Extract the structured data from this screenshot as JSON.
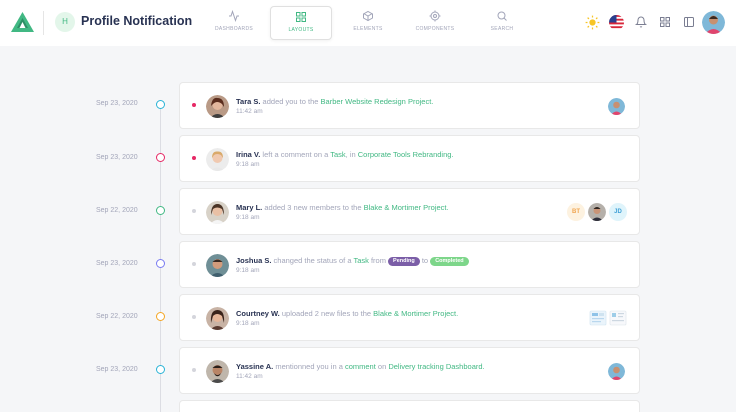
{
  "header": {
    "page_initial": "H",
    "page_title": "Profile Notification"
  },
  "nav": {
    "tabs": [
      {
        "label": "DASHBOARDS",
        "icon": "activity-icon",
        "active": false
      },
      {
        "label": "LAYOUTS",
        "icon": "grid-icon",
        "active": true
      },
      {
        "label": "ELEMENTS",
        "icon": "box-icon",
        "active": false
      },
      {
        "label": "COMPONENTS",
        "icon": "cog-icon",
        "active": false
      },
      {
        "label": "SEARCH",
        "icon": "search-icon",
        "active": false
      }
    ],
    "right_icons": [
      "sun-icon",
      "us-flag-icon",
      "bell-icon",
      "apps-grid-icon",
      "sidebar-toggle-icon",
      "user-avatar"
    ]
  },
  "colors": {
    "accent": "#41b883",
    "unread": "#e62965",
    "pending": "#7b5ea7",
    "completed": "#7dd68a"
  },
  "notifications": [
    {
      "date": "Sep 23, 2020",
      "dot_color": "#29b3d6",
      "unread": true,
      "name": "Tara S.",
      "text1": " added you to the ",
      "link1": "Barber Website Redesign Project.",
      "time": "11:42 am"
    },
    {
      "date": "Sep 23, 2020",
      "dot_color": "#e62965",
      "unread": true,
      "name": "Irina V.",
      "text1": " left a comment on a ",
      "link1": "Task",
      "text2": ", in ",
      "link2": "Corporate Tools Rebranding.",
      "time": "9:18 am"
    },
    {
      "date": "Sep 22, 2020",
      "dot_color": "#41b883",
      "unread": false,
      "name": "Mary L.",
      "text1": " added 3 new members to the ",
      "link1": "Blake & Mortimer Project.",
      "time": "9:18 am",
      "members": [
        {
          "initials": "BT",
          "bg": "#fdf2e0",
          "color": "#f0a550"
        },
        {
          "initials": "JD",
          "bg": "#dff4fb",
          "color": "#3d9fd6"
        }
      ]
    },
    {
      "date": "Sep 23, 2020",
      "dot_color": "#797bf2",
      "unread": false,
      "name": "Joshua S.",
      "text1": " changed the status of a ",
      "link1": "Task",
      "text2": " from ",
      "tag1": "Pending",
      "text3": " to ",
      "tag2": "Completed",
      "time": "9:18 am"
    },
    {
      "date": "Sep 22, 2020",
      "dot_color": "#f5a623",
      "unread": false,
      "name": "Courtney W.",
      "text1": " uploaded 2 new files to the ",
      "link1": "Blake & Mortimer Project.",
      "time": "9:18 am"
    },
    {
      "date": "Sep 23, 2020",
      "dot_color": "#29b3d6",
      "unread": false,
      "name": "Yassine A.",
      "text1": " mentionned you in a ",
      "link1": "comment",
      "text2": " on ",
      "link2": "Delivery tracking Dashboard.",
      "time": "11:42 am"
    }
  ]
}
